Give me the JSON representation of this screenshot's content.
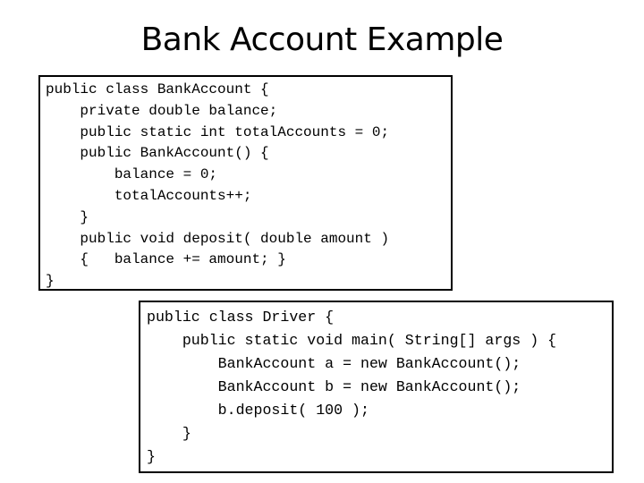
{
  "slide": {
    "title": "Bank Account Example"
  },
  "bank_account_code": {
    "lines": [
      "public class BankAccount {",
      "    private double balance;",
      "    public static int totalAccounts = 0;",
      "    public BankAccount() {",
      "        balance = 0;",
      "        totalAccounts++;",
      "    }",
      "    public void deposit( double amount )",
      "    {   balance += amount; }",
      "}"
    ]
  },
  "driver_code": {
    "lines": [
      "public class Driver {",
      "    public static void main( String[] args ) {",
      "        BankAccount a = new BankAccount();",
      "        BankAccount b = new BankAccount();",
      "        b.deposit( 100 );",
      "    }",
      "}"
    ]
  }
}
